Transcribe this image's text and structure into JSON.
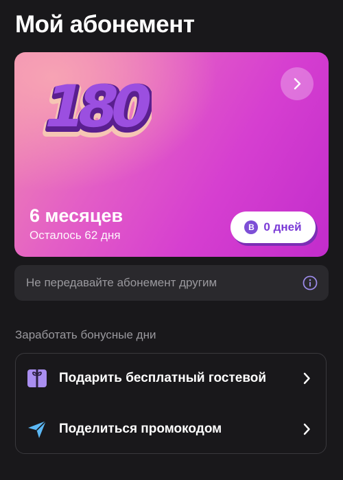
{
  "page": {
    "title": "Мой абонемент"
  },
  "subscription": {
    "logo_text": "180",
    "plan": "6 месяцев",
    "remaining": "Осталось 62 дня",
    "days_coin": "B",
    "days_label": "0 дней",
    "gradient_colors": [
      "#f7a3b4",
      "#e35ec6",
      "#c22ccc"
    ]
  },
  "notice": {
    "text": "Не передавайте абонемент другим",
    "icon": "info-icon"
  },
  "bonus": {
    "section_title": "Заработать бонусные дни",
    "items": [
      {
        "label": "Подарить бесплатный гостевой",
        "icon": "gift-icon"
      },
      {
        "label": "Поделиться промокодом",
        "icon": "send-icon"
      }
    ]
  },
  "colors": {
    "background": "#19181b",
    "accent": "#7d4fd6",
    "muted_text": "#9a999e"
  }
}
